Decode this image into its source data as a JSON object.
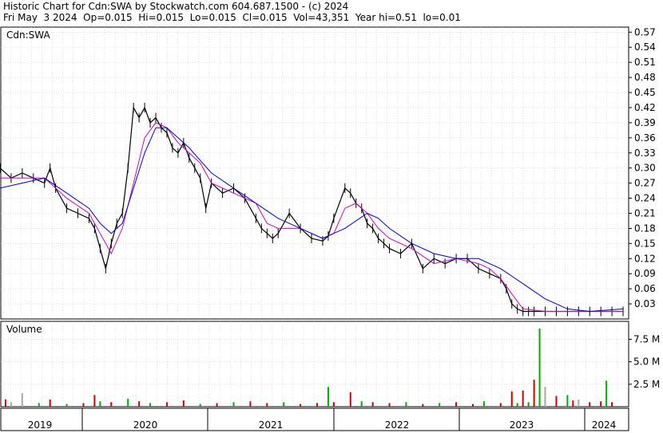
{
  "header": {
    "line1": "Historic Chart for Cdn:SWA by Stockwatch.com 604.687.1500 - (c) 2024",
    "line2": "Fri May  3 2024  Op=0.015  Hi=0.015  Lo=0.015  Cl=0.015  Vol=43,351  Year hi=0.51  lo=0.01"
  },
  "chart_data": [
    {
      "type": "line",
      "panel_label": "Cdn:SWA",
      "ylim": [
        0.0,
        0.58
      ],
      "ytick_labels": [
        "0.57",
        "0.54",
        "0.51",
        "0.48",
        "0.45",
        "0.42",
        "0.39",
        "0.36",
        "0.33",
        "0.30",
        "0.27",
        "0.24",
        "0.21",
        "0.18",
        "0.15",
        "0.12",
        "0.09",
        "0.06",
        "0.03"
      ],
      "ytick_values": [
        0.57,
        0.54,
        0.51,
        0.48,
        0.45,
        0.42,
        0.39,
        0.36,
        0.33,
        0.3,
        0.27,
        0.24,
        0.21,
        0.18,
        0.15,
        0.12,
        0.09,
        0.06,
        0.03
      ],
      "grid": true,
      "x_years": [
        "2019",
        "2020",
        "2021",
        "2022",
        "2023",
        "2024"
      ],
      "series": [
        {
          "color": "#000000",
          "x": [
            2018.7,
            2018.8,
            2018.9,
            2019.0,
            2019.1,
            2019.15,
            2019.2,
            2019.3,
            2019.4,
            2019.5,
            2019.55,
            2019.6,
            2019.65,
            2019.7,
            2019.75,
            2019.8,
            2019.85,
            2019.9,
            2019.95,
            2020.0,
            2020.05,
            2020.1,
            2020.15,
            2020.2,
            2020.25,
            2020.3,
            2020.35,
            2020.4,
            2020.45,
            2020.5,
            2020.55,
            2020.6,
            2020.7,
            2020.8,
            2020.9,
            2021.0,
            2021.05,
            2021.1,
            2021.15,
            2021.2,
            2021.3,
            2021.4,
            2021.5,
            2021.6,
            2021.65,
            2021.7,
            2021.8,
            2021.85,
            2021.9,
            2021.95,
            2022.0,
            2022.05,
            2022.1,
            2022.15,
            2022.2,
            2022.3,
            2022.4,
            2022.5,
            2022.6,
            2022.7,
            2022.8,
            2022.9,
            2023.0,
            2023.1,
            2023.2,
            2023.25,
            2023.3,
            2023.35,
            2023.4,
            2023.45,
            2023.5,
            2023.6,
            2023.7,
            2023.8,
            2023.9,
            2024.0,
            2024.1,
            2024.2,
            2024.3
          ],
          "y": [
            0.3,
            0.28,
            0.29,
            0.28,
            0.27,
            0.3,
            0.26,
            0.22,
            0.21,
            0.2,
            0.18,
            0.14,
            0.1,
            0.15,
            0.19,
            0.21,
            0.3,
            0.42,
            0.4,
            0.42,
            0.39,
            0.4,
            0.38,
            0.37,
            0.34,
            0.33,
            0.35,
            0.32,
            0.3,
            0.28,
            0.22,
            0.27,
            0.25,
            0.26,
            0.24,
            0.2,
            0.18,
            0.17,
            0.16,
            0.17,
            0.21,
            0.18,
            0.16,
            0.155,
            0.165,
            0.2,
            0.26,
            0.25,
            0.23,
            0.22,
            0.19,
            0.18,
            0.16,
            0.15,
            0.14,
            0.13,
            0.15,
            0.1,
            0.12,
            0.11,
            0.12,
            0.12,
            0.1,
            0.09,
            0.08,
            0.06,
            0.03,
            0.02,
            0.015,
            0.015,
            0.015,
            0.015,
            0.015,
            0.015,
            0.015,
            0.015,
            0.015,
            0.015,
            0.015
          ]
        },
        {
          "color": "#cc00cc",
          "x": [
            2018.7,
            2018.9,
            2019.1,
            2019.3,
            2019.5,
            2019.6,
            2019.7,
            2019.8,
            2019.9,
            2020.0,
            2020.1,
            2020.2,
            2020.3,
            2020.4,
            2020.5,
            2020.6,
            2020.8,
            2021.0,
            2021.1,
            2021.2,
            2021.4,
            2021.6,
            2021.7,
            2021.8,
            2021.9,
            2022.0,
            2022.1,
            2022.2,
            2022.4,
            2022.6,
            2022.8,
            2023.0,
            2023.1,
            2023.2,
            2023.3,
            2023.4,
            2023.6,
            2023.8,
            2024.0,
            2024.3
          ],
          "y": [
            0.28,
            0.28,
            0.28,
            0.24,
            0.21,
            0.17,
            0.13,
            0.18,
            0.27,
            0.36,
            0.39,
            0.38,
            0.35,
            0.33,
            0.31,
            0.27,
            0.25,
            0.23,
            0.19,
            0.18,
            0.18,
            0.16,
            0.17,
            0.22,
            0.23,
            0.21,
            0.18,
            0.16,
            0.14,
            0.11,
            0.12,
            0.11,
            0.1,
            0.08,
            0.05,
            0.02,
            0.015,
            0.015,
            0.015,
            0.015
          ]
        },
        {
          "color": "#0000cc",
          "x": [
            2018.7,
            2018.9,
            2019.1,
            2019.3,
            2019.5,
            2019.6,
            2019.7,
            2019.8,
            2019.9,
            2020.0,
            2020.1,
            2020.2,
            2020.3,
            2020.4,
            2020.6,
            2020.8,
            2021.0,
            2021.2,
            2021.4,
            2021.6,
            2021.8,
            2022.0,
            2022.1,
            2022.2,
            2022.4,
            2022.6,
            2022.8,
            2023.0,
            2023.2,
            2023.4,
            2023.6,
            2023.8,
            2024.0,
            2024.3
          ],
          "y": [
            0.26,
            0.27,
            0.28,
            0.25,
            0.22,
            0.19,
            0.17,
            0.19,
            0.26,
            0.33,
            0.38,
            0.38,
            0.36,
            0.34,
            0.29,
            0.26,
            0.23,
            0.2,
            0.18,
            0.16,
            0.18,
            0.21,
            0.2,
            0.18,
            0.15,
            0.13,
            0.12,
            0.12,
            0.1,
            0.07,
            0.04,
            0.02,
            0.015,
            0.02
          ]
        }
      ]
    },
    {
      "type": "bar",
      "panel_label": "Volume",
      "ylim": [
        0,
        9.5
      ],
      "ytick_labels": [
        "7.5 M",
        "5.0 M",
        "2.5 M"
      ],
      "ytick_values": [
        7.5,
        5.0,
        2.5
      ],
      "bars": {
        "x": [
          2018.75,
          2018.8,
          2018.9,
          2019.05,
          2019.15,
          2019.3,
          2019.45,
          2019.55,
          2019.6,
          2019.7,
          2019.85,
          2019.95,
          2020.05,
          2020.2,
          2020.35,
          2020.5,
          2020.65,
          2020.8,
          2020.95,
          2021.1,
          2021.25,
          2021.4,
          2021.55,
          2021.65,
          2021.7,
          2021.85,
          2021.95,
          2022.05,
          2022.2,
          2022.35,
          2022.5,
          2022.65,
          2022.8,
          2022.95,
          2023.05,
          2023.2,
          2023.3,
          2023.35,
          2023.4,
          2023.45,
          2023.5,
          2023.55,
          2023.6,
          2023.7,
          2023.8,
          2023.85,
          2023.9,
          2024.0,
          2024.1,
          2024.15,
          2024.2
        ],
        "values": [
          0.8,
          0.5,
          1.5,
          0.4,
          0.8,
          0.3,
          0.4,
          1.3,
          0.6,
          0.5,
          0.9,
          0.6,
          0.4,
          0.5,
          0.7,
          0.3,
          0.4,
          0.5,
          0.6,
          0.4,
          0.5,
          0.3,
          0.4,
          2.2,
          0.5,
          1.6,
          0.6,
          0.5,
          0.4,
          0.5,
          0.3,
          0.4,
          0.5,
          0.3,
          0.6,
          0.4,
          1.7,
          0.4,
          1.8,
          0.5,
          3.0,
          8.7,
          2.2,
          1.2,
          1.3,
          0.7,
          0.8,
          0.5,
          0.6,
          2.9,
          0.5
        ],
        "colors": [
          "#cc0000",
          "#aaaaaa",
          "#aaaaaa",
          "#00aa00",
          "#cc0000",
          "#00aa00",
          "#cc0000",
          "#cc0000",
          "#00aa00",
          "#cc0000",
          "#00aa00",
          "#cc0000",
          "#00aa00",
          "#cc0000",
          "#cc0000",
          "#00aa00",
          "#cc0000",
          "#00aa00",
          "#cc0000",
          "#cc0000",
          "#00aa00",
          "#cc0000",
          "#cc0000",
          "#00aa00",
          "#cc0000",
          "#cc0000",
          "#00aa00",
          "#cc0000",
          "#cc0000",
          "#00aa00",
          "#cc0000",
          "#00aa00",
          "#cc0000",
          "#cc0000",
          "#00aa00",
          "#cc0000",
          "#cc0000",
          "#00aa00",
          "#cc0000",
          "#00aa00",
          "#cc0000",
          "#00aa00",
          "#aaaaaa",
          "#cc0000",
          "#00aa00",
          "#cc0000",
          "#aaaaaa",
          "#cc0000",
          "#cc0000",
          "#00aa00",
          "#cc0000"
        ]
      }
    }
  ]
}
